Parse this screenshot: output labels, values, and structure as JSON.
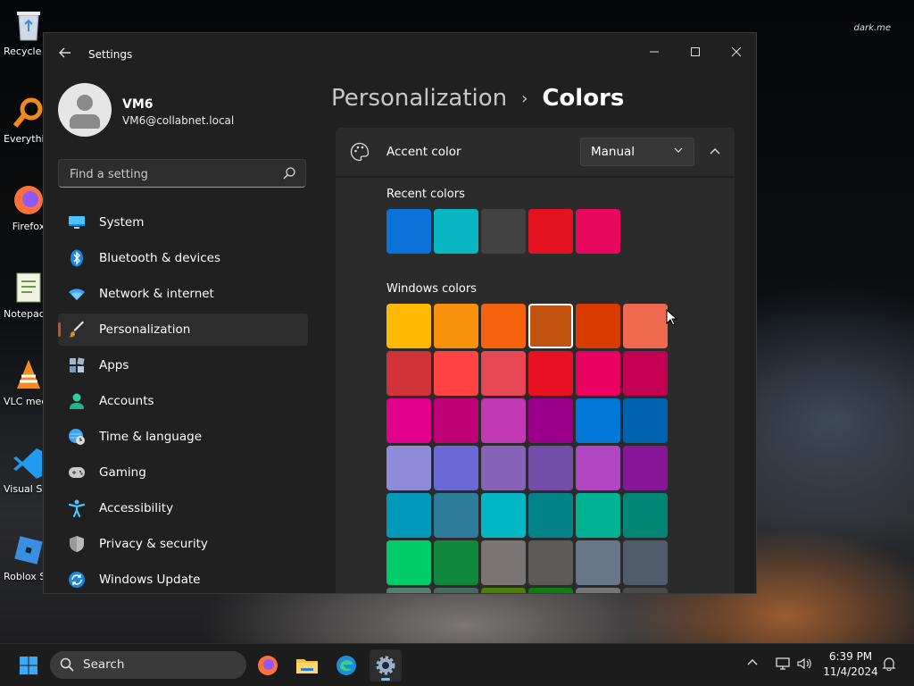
{
  "desktop": {
    "icons": [
      {
        "label": "Recycle Bin",
        "icon": "recycle-bin-icon"
      },
      {
        "label": "Everything",
        "icon": "everything-search-icon"
      },
      {
        "label": "Firefox",
        "icon": "firefox-icon"
      },
      {
        "label": "Notepad++",
        "icon": "notepad-icon"
      },
      {
        "label": "VLC media player",
        "icon": "vlc-icon"
      },
      {
        "label": "Visual Studio Code",
        "icon": "vscode-icon"
      },
      {
        "label": "Roblox Studio",
        "icon": "roblox-icon"
      }
    ],
    "watermark": "dark.me"
  },
  "window": {
    "title": "Settings",
    "user": {
      "name": "VM6",
      "email": "VM6@collabnet.local"
    },
    "search_placeholder": "Find a setting",
    "nav": [
      {
        "label": "System",
        "icon": "monitor-icon",
        "active": false
      },
      {
        "label": "Bluetooth & devices",
        "icon": "bluetooth-icon",
        "active": false
      },
      {
        "label": "Network & internet",
        "icon": "wifi-icon",
        "active": false
      },
      {
        "label": "Personalization",
        "icon": "brush-icon",
        "active": true
      },
      {
        "label": "Apps",
        "icon": "apps-icon",
        "active": false
      },
      {
        "label": "Accounts",
        "icon": "person-icon",
        "active": false
      },
      {
        "label": "Time & language",
        "icon": "globe-clock-icon",
        "active": false
      },
      {
        "label": "Gaming",
        "icon": "gamepad-icon",
        "active": false
      },
      {
        "label": "Accessibility",
        "icon": "accessibility-icon",
        "active": false
      },
      {
        "label": "Privacy & security",
        "icon": "shield-icon",
        "active": false
      },
      {
        "label": "Windows Update",
        "icon": "update-icon",
        "active": false
      }
    ],
    "breadcrumb": {
      "parent": "Personalization",
      "separator": "›",
      "current": "Colors"
    },
    "accent": {
      "label": "Accent color",
      "mode": "Manual",
      "recent_label": "Recent colors",
      "recent_colors": [
        "#0a72d8",
        "#09b7c2",
        "#424242",
        "#e5121f",
        "#e8095e"
      ],
      "windows_label": "Windows colors",
      "windows_colors": [
        [
          "#ffb900",
          "#f7900b",
          "#f7630c",
          "#c1530f",
          "#da3b01",
          "#ef6950"
        ],
        [
          "#d13438",
          "#ff4343",
          "#e74856",
          "#e81123",
          "#ea005e",
          "#c30052"
        ],
        [
          "#e3008c",
          "#bf0077",
          "#c239b3",
          "#9a0089",
          "#0078d7",
          "#0063b1"
        ],
        [
          "#8e8cd8",
          "#6b69d6",
          "#8764b8",
          "#744da9",
          "#b146c2",
          "#881798"
        ],
        [
          "#0099bc",
          "#2d7d9a",
          "#00b7c3",
          "#038387",
          "#00b294",
          "#018574"
        ],
        [
          "#00cc6a",
          "#10893e",
          "#7a7574",
          "#5d5a58",
          "#68768a",
          "#515c6b"
        ],
        [
          "#567c73",
          "#486860",
          "#498205",
          "#107c10",
          "#767676",
          "#4c4a48"
        ]
      ],
      "selected": [
        0,
        3
      ]
    }
  },
  "taskbar": {
    "search_label": "Search",
    "apps": [
      "start-icon",
      "firefox-icon",
      "file-explorer-icon",
      "edge-icon",
      "settings-icon"
    ],
    "time": "6:39 PM",
    "date": "11/4/2024"
  }
}
